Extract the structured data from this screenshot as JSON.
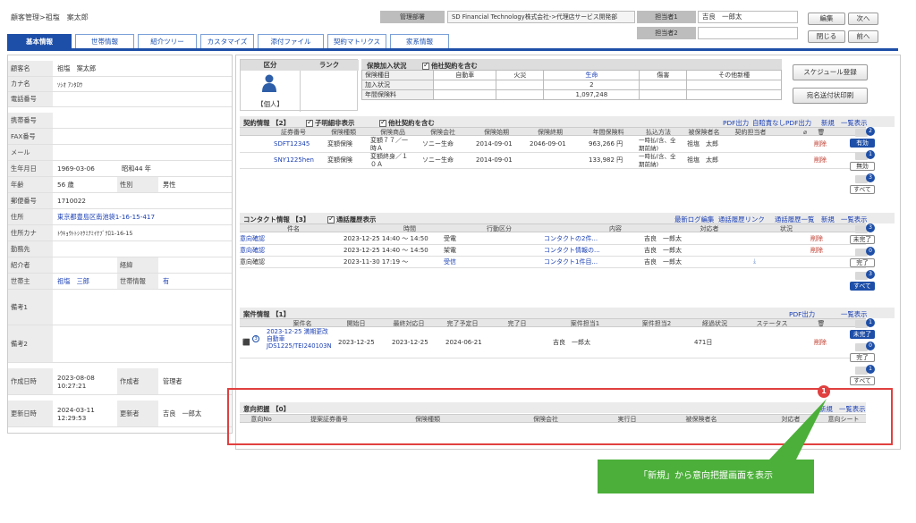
{
  "header": {
    "breadcrumb": "顧客管理>祖塩　案太郎",
    "dept_label": "管理部署",
    "dept_value": "SD Financial Technology株式会社->代理店サービス開発部",
    "tanto1_label": "担当者1",
    "tanto1_value": "吉良　一郎太",
    "tanto2_label": "担当者2",
    "tanto2_value": "",
    "edit_btn": "編集",
    "next_btn": "次へ",
    "close_btn": "閉じる",
    "prev_btn": "前へ"
  },
  "tabs": [
    "基本情報",
    "世帯情報",
    "紹介ツリー",
    "カスタマイズ",
    "添付ファイル",
    "契約マトリクス",
    "家系情報"
  ],
  "customer": {
    "rows": [
      {
        "label": "顧客名",
        "value": "祖塩　案太郎"
      },
      {
        "label": "カナ名",
        "value": "ｿｼｵ ｱﾝﾀﾛｳ"
      },
      {
        "label": "電話番号",
        "value": ""
      },
      {
        "label": "携帯番号",
        "value": ""
      },
      {
        "label": "FAX番号",
        "value": ""
      },
      {
        "label": "メール",
        "value": ""
      },
      {
        "label": "生年月日",
        "value": "1969-03-06",
        "extra": "昭和44 年"
      },
      {
        "label": "年齢",
        "value": "56 歳",
        "label2": "性別",
        "value2": "男性"
      },
      {
        "label": "郵便番号",
        "value": "1710022"
      },
      {
        "label": "住所",
        "value": "東京都豊島区南池袋1-16-15-417"
      },
      {
        "label": "住所カナ",
        "value": "ﾄｳｷｮｳﾄﾄｼﾏｸﾐﾅﾐｲｹﾌﾞｸﾛ1-16-15"
      },
      {
        "label": "勤務先",
        "value": ""
      },
      {
        "label": "紹介者",
        "value": "",
        "label2": "経緯",
        "value2": ""
      },
      {
        "label": "世帯主",
        "value": "祖塩　三郎",
        "label2": "世帯情報",
        "value2": "有"
      },
      {
        "label": "備考1",
        "value": ""
      },
      {
        "label": "備考2",
        "value": ""
      },
      {
        "label": "作成日時",
        "value": "2023-08-08\n10:27:21",
        "label2": "作成者",
        "value2": "管理者"
      },
      {
        "label": "更新日時",
        "value": "2024-03-11\n12:29:53",
        "label2": "更新者",
        "value2": "吉良　一郎太"
      }
    ]
  },
  "summary": {
    "kubun_label": "区分",
    "rank_label": "ランク",
    "person_caption": "【個人】",
    "status_label": "保険加入状況",
    "other_contract": "他社契約を含む",
    "rows": [
      "保険種目",
      "加入状況",
      "年間保険料"
    ],
    "cols": [
      "自動車",
      "火災",
      "生命",
      "傷害",
      "その他新種"
    ],
    "life_count": "2",
    "life_premium": "1,097,248",
    "schedule_btn": "スケジュール登録",
    "print_btn": "宛名送付状印刷"
  },
  "contracts": {
    "title": "契約情報 【2】",
    "opt1": "子明細非表示",
    "opt2": "他社契約を含む",
    "links": [
      "PDF出力",
      "自賠責なしPDF出力",
      "新規",
      "一覧表示"
    ],
    "headers": [
      "証券番号",
      "保険種類",
      "保険商品",
      "保険会社",
      "保険始期",
      "保険終期",
      "年間保険料",
      "払込方法",
      "被保険者名",
      "契約担当者"
    ],
    "rows": [
      {
        "no": "SDFT12345",
        "kind": "変額保険",
        "product": "変額７７／一時Ａ",
        "company": "ソニー生命",
        "start": "2014-09-01",
        "end": "2046-09-01",
        "premium": "963,266 円",
        "pay": "一時払(含、全期前納)",
        "insured": "祖塩　太郎",
        "del": "削除"
      },
      {
        "no": "SNY1225hen",
        "kind": "変額保険",
        "product": "変額終身／１０Ａ",
        "company": "ソニー生命",
        "start": "2014-09-01",
        "end": "",
        "premium": "133,982 円",
        "pay": "一時払(含、全期前納)",
        "insured": "祖塩　太郎",
        "del": "削除"
      }
    ],
    "side": {
      "valid": "有効",
      "invalid": "無効",
      "all": "すべて",
      "b1": "2",
      "b2": "1",
      "b3": "3"
    }
  },
  "contacts": {
    "title": "コンタクト情報 【3】",
    "opt": "通話履歴表示",
    "links": [
      "最新ログ編集",
      "通話履歴リンク",
      "通話履歴一覧",
      "新規",
      "一覧表示"
    ],
    "headers": [
      "件名",
      "時間",
      "行動区分",
      "内容",
      "対応者",
      "状況"
    ],
    "rows": [
      {
        "subject": "意向確認",
        "time": "2023-12-25 14:40 〜 14:50",
        "type": "受電",
        "content": "コンタクトの2件...",
        "person": "吉良　一郎太",
        "del": "削除"
      },
      {
        "subject": "意向確認",
        "time": "2023-12-25 14:40 〜 14:50",
        "type": "架電",
        "content": "コンタクト情報の...",
        "person": "吉良　一郎太",
        "del": "削除"
      },
      {
        "subject": "意向確認",
        "time": "2023-11-30 17:19 〜",
        "type": "受信",
        "content": "コンタクト1件目...",
        "person": "吉良　一郎太",
        "del": ""
      }
    ],
    "side": {
      "incomplete": "未完了",
      "complete": "完了",
      "all": "すべて",
      "b1": "3",
      "b2": "0",
      "b3": "3"
    }
  },
  "cases": {
    "title": "案件情報 【1】",
    "links": [
      "PDF出力",
      "一覧表示"
    ],
    "headers": [
      "案件名",
      "開始日",
      "最終対応日",
      "完了予定日",
      "完了日",
      "案件担当1",
      "案件担当2",
      "経過状況",
      "ステータス"
    ],
    "rows": [
      {
        "name": "2023-12-25 満期更改 自動車 JDS1225/TEI240103N",
        "start": "2023-12-25",
        "last": "2023-12-25",
        "plan": "2024-06-21",
        "done": "",
        "tanto1": "吉良　一郎太",
        "tanto2": "",
        "elapsed": "471日",
        "status": "",
        "del": "削除",
        "badge": "3"
      }
    ],
    "side": {
      "incomplete": "未完了",
      "complete": "完了",
      "all": "すべて",
      "b1": "1",
      "b2": "0",
      "b3": "1"
    }
  },
  "intent": {
    "title": "意向把握 【0】",
    "links": [
      "新規",
      "一覧表示"
    ],
    "headers": [
      "意向No",
      "提案証券番号",
      "保険種類",
      "保険会社",
      "実行日",
      "被保険者名",
      "対応者",
      "意向シート"
    ],
    "marker": "1"
  },
  "callout": {
    "text": "「新規」から意向把握画面を表示"
  },
  "colors": {
    "accent": "#1e4fa8",
    "highlight": "#e0403f",
    "callout": "#4caf3a"
  }
}
